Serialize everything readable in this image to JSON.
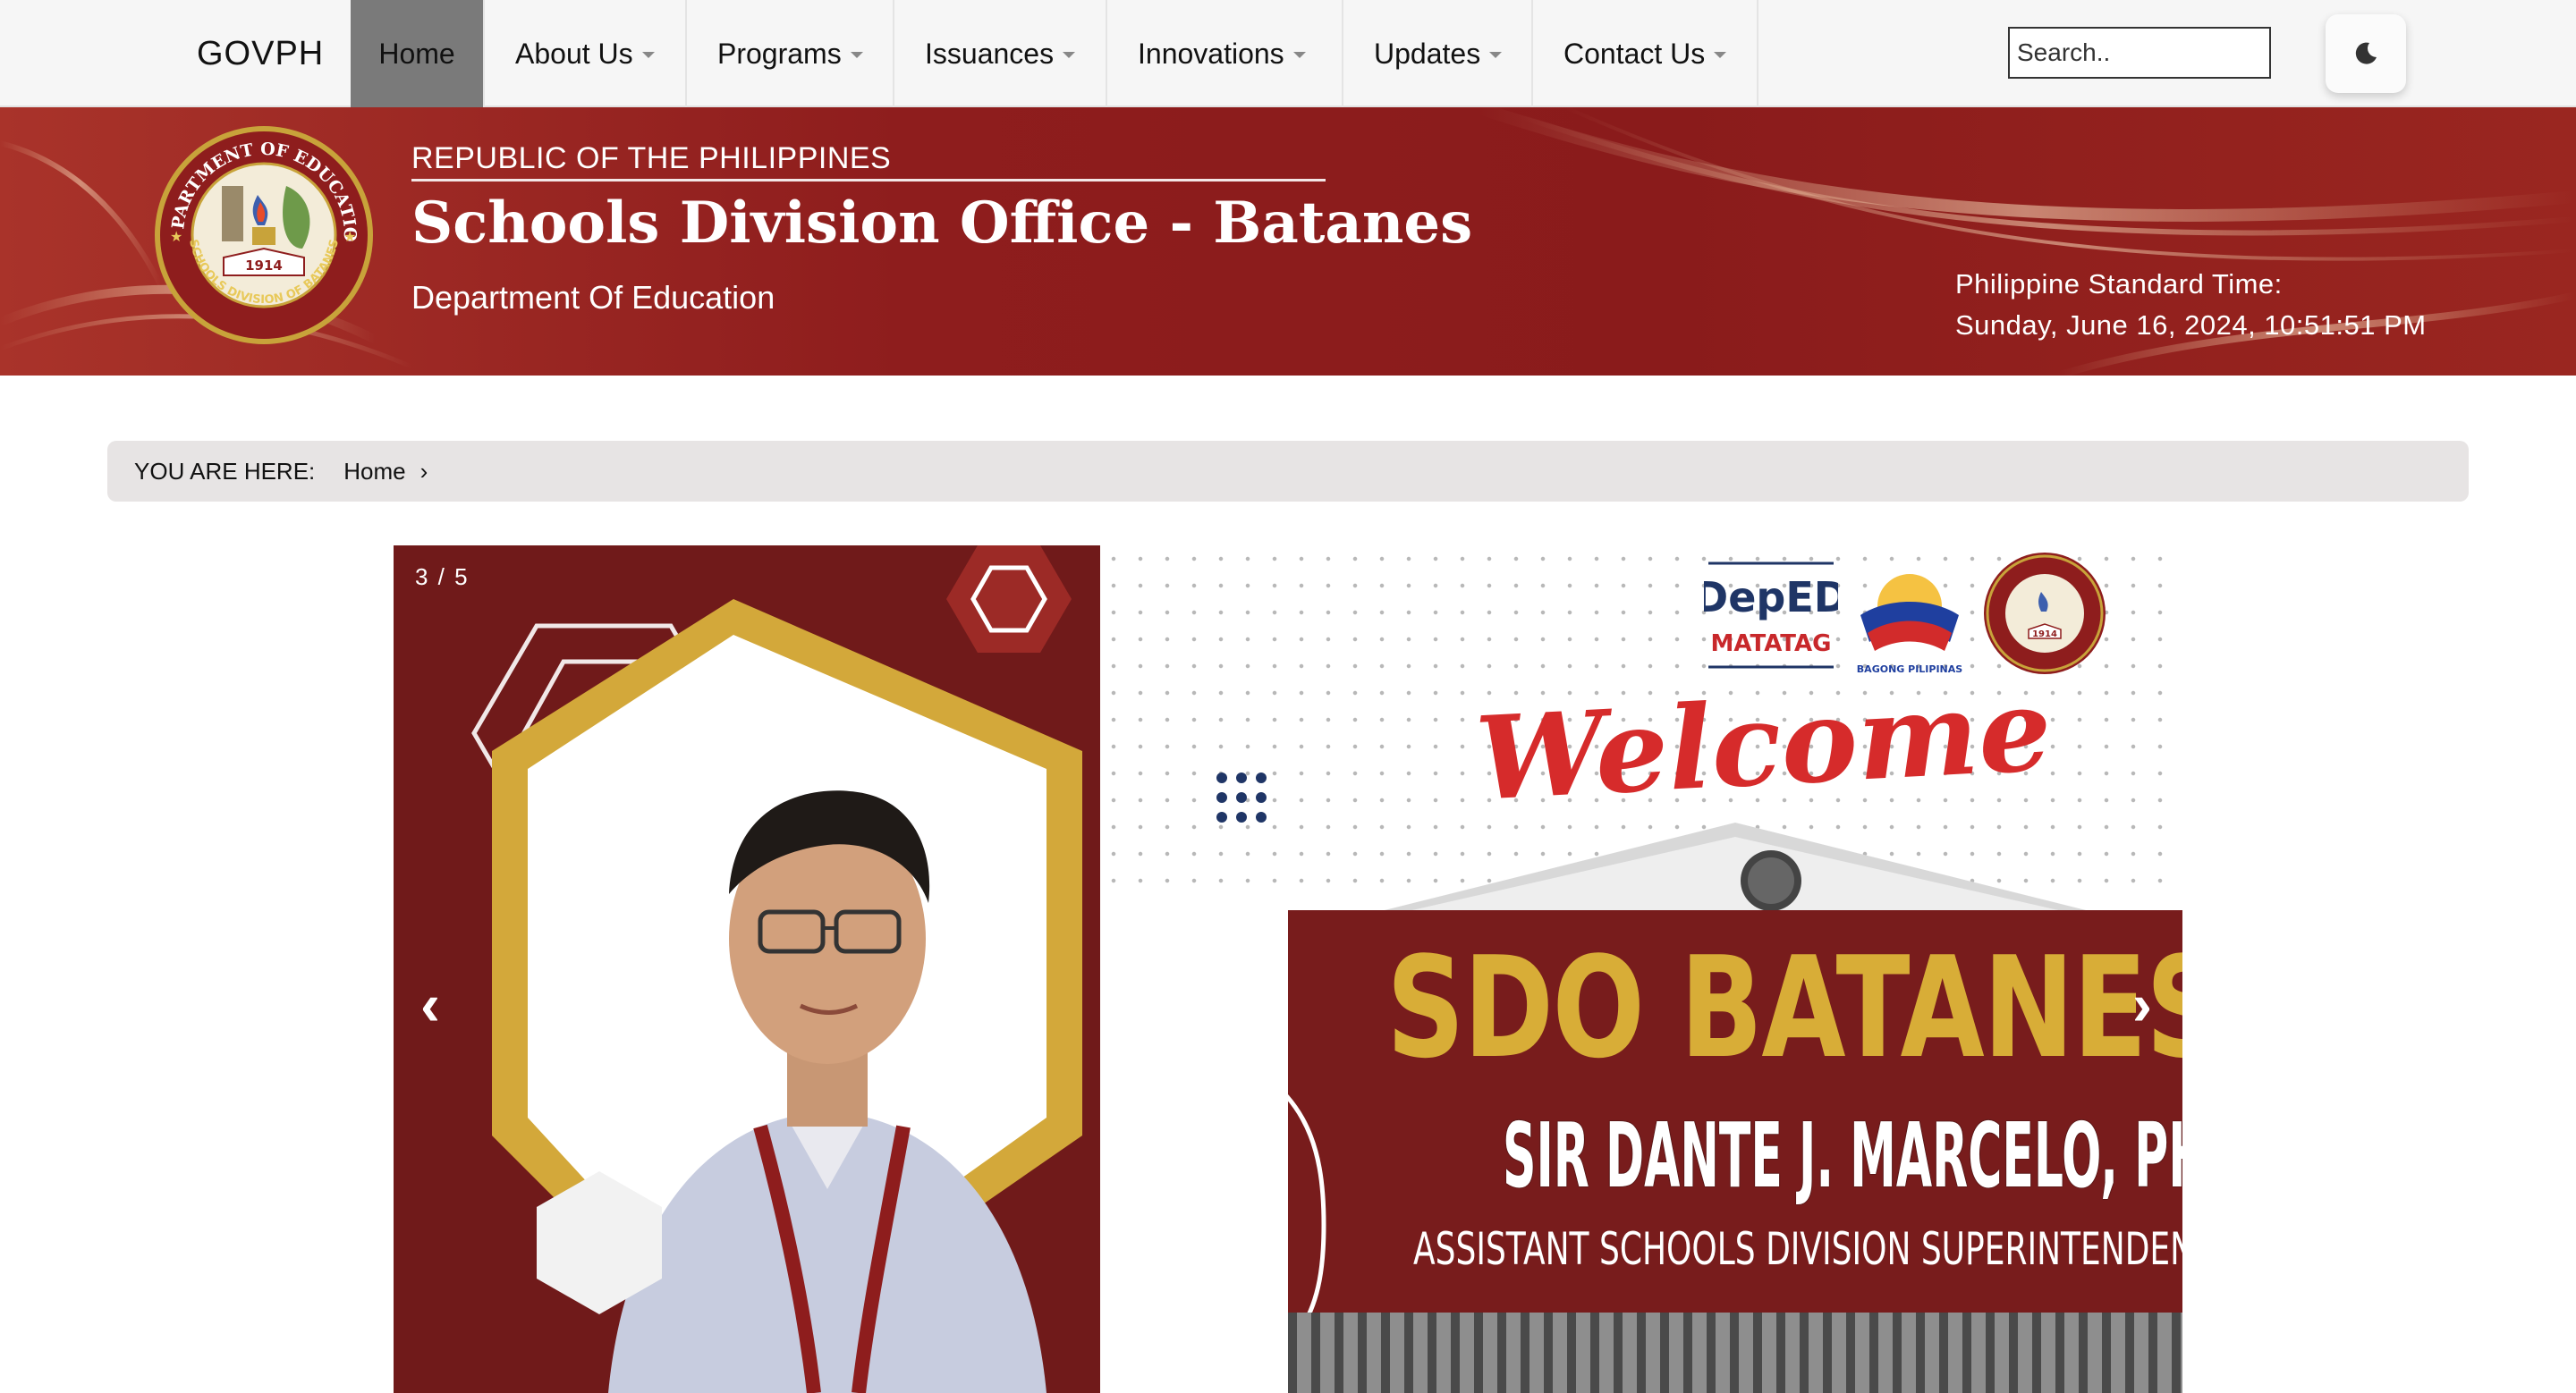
{
  "nav": {
    "brand": "GOVPH",
    "items": [
      {
        "label": "Home",
        "active": true,
        "dropdown": false
      },
      {
        "label": "About Us",
        "active": false,
        "dropdown": true
      },
      {
        "label": "Programs",
        "active": false,
        "dropdown": true
      },
      {
        "label": "Issuances",
        "active": false,
        "dropdown": true
      },
      {
        "label": "Innovations",
        "active": false,
        "dropdown": true
      },
      {
        "label": "Updates",
        "active": false,
        "dropdown": true
      },
      {
        "label": "Contact Us",
        "active": false,
        "dropdown": true
      }
    ],
    "search_placeholder": "Search..",
    "theme_toggle_icon": "moon-icon"
  },
  "header": {
    "kicker": "REPUBLIC OF THE PHILIPPINES",
    "title": "Schools Division Office - Batanes",
    "subtitle": "Department Of Education",
    "pst_label": "Philippine Standard Time:",
    "pst_value": "Sunday, June 16, 2024, 10:51:51 PM",
    "seal_text_top": "DEPARTMENT OF EDUCATION",
    "seal_text_bottom": "SCHOOLS DIVISION OF BATANES",
    "seal_year": "1914",
    "colors": {
      "banner": "#8e1d1d",
      "text": "#ffffff"
    }
  },
  "breadcrumb": {
    "label": "YOU ARE HERE:",
    "items": [
      "Home"
    ]
  },
  "carousel": {
    "counter": "3 / 5",
    "prev_label": "‹",
    "next_label": "›",
    "slide": {
      "welcome": "Welcome",
      "headline": "SDO BATANES",
      "name": "SIR DANTE J. MARCELO, PHD, CESO VI",
      "role": "ASSISTANT SCHOOLS DIVISION SUPERINTENDENT",
      "logos": [
        {
          "name": "DepED MATATAG",
          "line1": "DepED",
          "line2": "MATATAG"
        },
        {
          "name": "BAGONG PILIPINAS",
          "line1": "BAGONG PILIPINAS"
        },
        {
          "name": "Schools Division of Batanes seal",
          "line1": "1914"
        }
      ],
      "colors": {
        "headline": "#d8ad37",
        "welcome": "#d62b2b",
        "band": "#781c1c"
      }
    }
  }
}
